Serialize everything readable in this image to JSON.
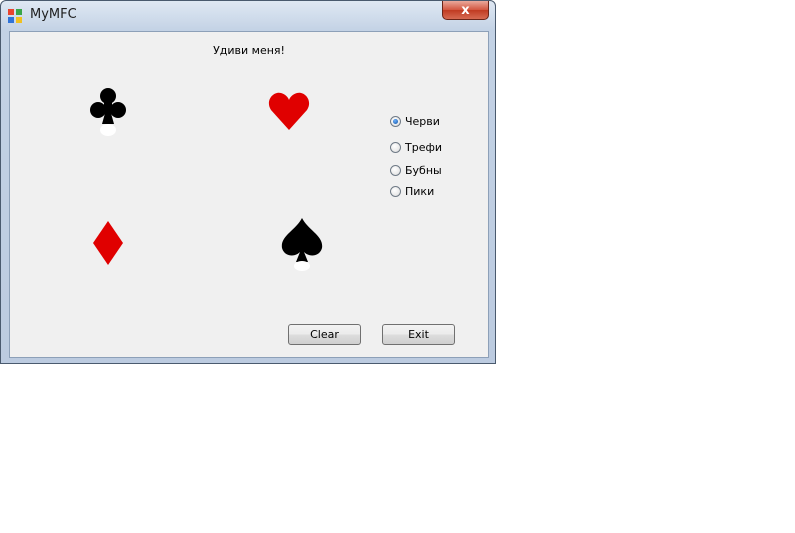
{
  "window": {
    "title": "MyMFC",
    "close_glyph": "x"
  },
  "dialog": {
    "heading": "Удиви меня!",
    "suits": [
      {
        "name": "club-icon",
        "color": "#000000"
      },
      {
        "name": "heart-icon",
        "color": "#e00000"
      },
      {
        "name": "diamond-icon",
        "color": "#e00000"
      },
      {
        "name": "spade-icon",
        "color": "#000000"
      }
    ],
    "radio_options": [
      {
        "label": "Черви",
        "checked": true
      },
      {
        "label": "Трефи",
        "checked": false
      },
      {
        "label": "Бубны",
        "checked": false
      },
      {
        "label": "Пики",
        "checked": false
      }
    ],
    "buttons": {
      "clear": "Clear",
      "exit": "Exit"
    }
  }
}
